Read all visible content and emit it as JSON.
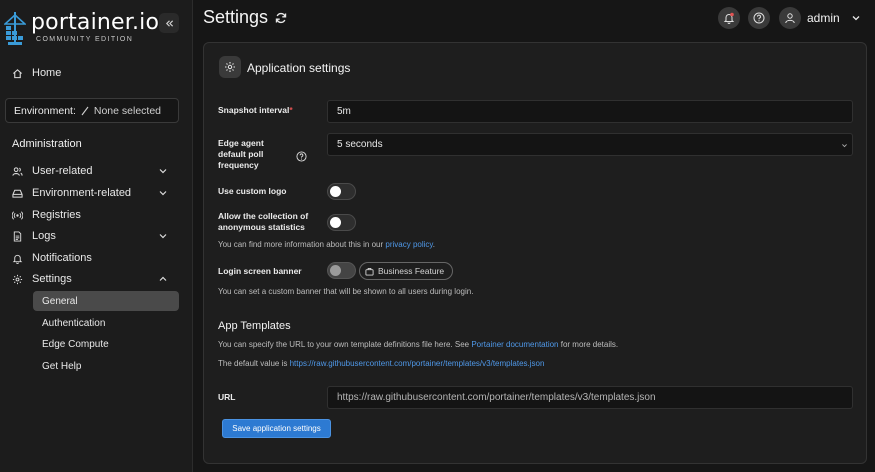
{
  "brand": {
    "name": "portainer.io",
    "edition": "COMMUNITY EDITION"
  },
  "sidebar": {
    "home": "Home",
    "environment": {
      "label": "Environment:",
      "value": "None selected"
    },
    "section": "Administration",
    "items": [
      {
        "label": "User-related"
      },
      {
        "label": "Environment-related"
      },
      {
        "label": "Registries"
      },
      {
        "label": "Logs"
      },
      {
        "label": "Notifications"
      },
      {
        "label": "Settings"
      }
    ],
    "settings_sub": [
      {
        "label": "General"
      },
      {
        "label": "Authentication"
      },
      {
        "label": "Edge Compute"
      },
      {
        "label": "Get Help"
      }
    ]
  },
  "header": {
    "title": "Settings",
    "user": "admin"
  },
  "panel": {
    "title": "Application settings",
    "snapshot_label": "Snapshot interval",
    "snapshot_value": "5m",
    "edge_label_1": "Edge agent",
    "edge_label_2": "default poll",
    "edge_label_3": "frequency",
    "edge_value": "5 seconds",
    "logo_label": "Use custom logo",
    "stats_label_1": "Allow the collection of",
    "stats_label_2": "anonymous statistics",
    "stats_hint": "You can find more information about this in our",
    "privacy_link": "privacy policy",
    "banner_label": "Login screen banner",
    "business_badge": "Business Feature",
    "banner_hint": "You can set a custom banner that will be shown to all users during login.",
    "templates_title": "App Templates",
    "templates_hint": "You can specify the URL to your own template definitions file here. See",
    "templates_doc_link": "Portainer documentation",
    "templates_hint_end": "for more details.",
    "default_label": "The default value is",
    "default_url": "https://raw.githubusercontent.com/portainer/templates/v3/templates.json",
    "url_label": "URL",
    "url_value": "https://raw.githubusercontent.com/portainer/templates/v3/templates.json",
    "save_button": "Save application settings"
  },
  "colors": {
    "accent": "#2d7ad2",
    "link": "#4f98e8",
    "required": "#e25353"
  }
}
